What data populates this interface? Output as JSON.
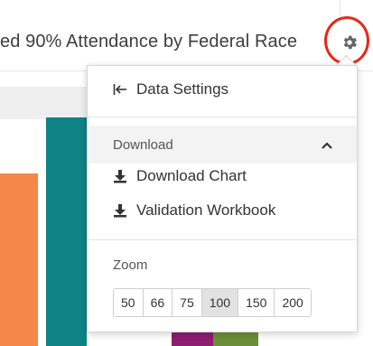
{
  "chart": {
    "title": "ed 90% Attendance by Federal Race",
    "bar_colors": [
      "#f6874a",
      "#0e8385",
      "#8e1e6f",
      "#6b8e3a"
    ]
  },
  "menu": {
    "data_settings_label": "Data Settings",
    "download_section_label": "Download",
    "download_chart_label": "Download Chart",
    "validation_workbook_label": "Validation Workbook",
    "zoom_label": "Zoom",
    "zoom_options": [
      "50",
      "66",
      "75",
      "100",
      "150",
      "200"
    ],
    "zoom_selected": "100"
  },
  "icons": {
    "settings": "gear-icon",
    "back": "arrow-left-bar-icon",
    "collapse": "chevron-up-icon",
    "download": "download-icon"
  },
  "colors": {
    "highlight": "#e8281a"
  }
}
